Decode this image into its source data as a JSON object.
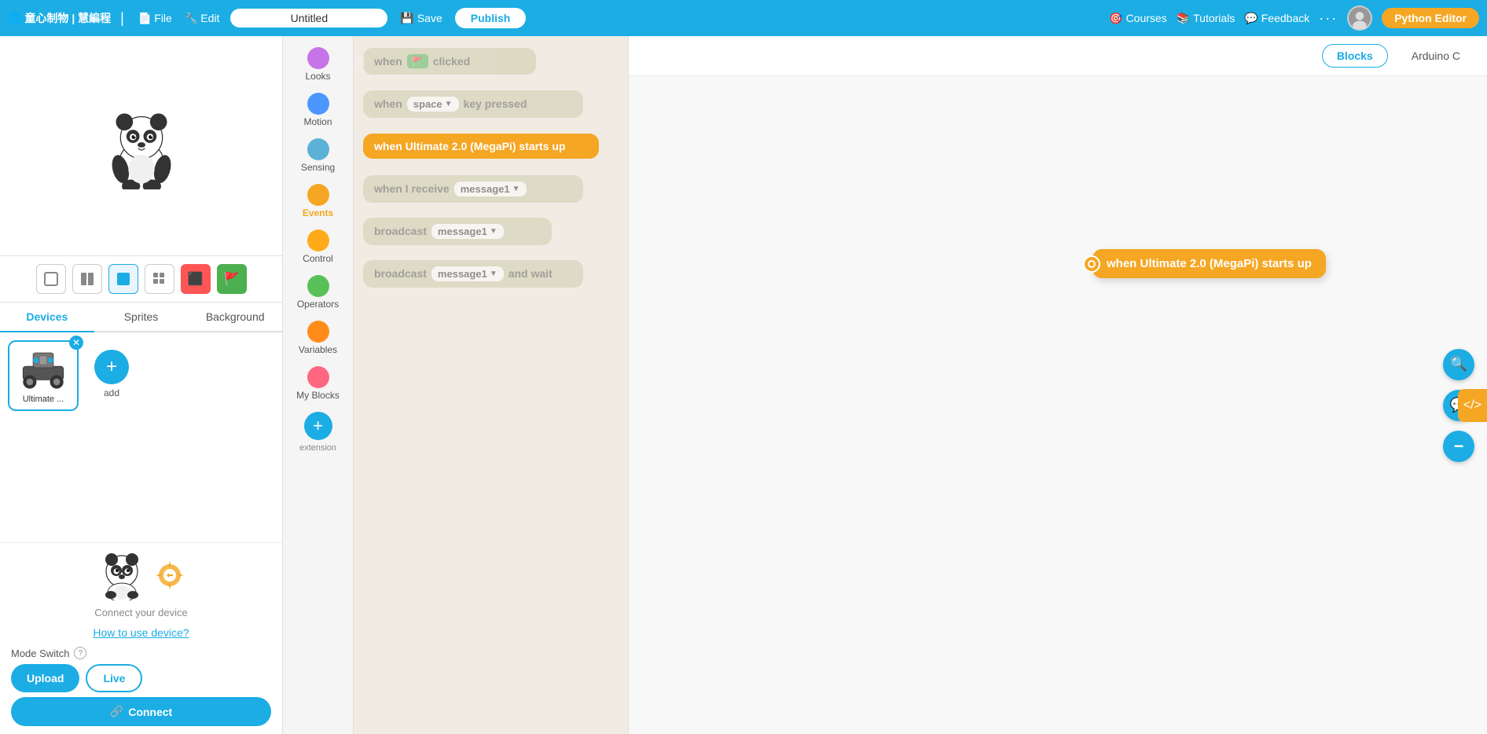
{
  "topnav": {
    "logo_text": "童心制物 | 慧編程",
    "file_label": "File",
    "edit_label": "Edit",
    "title_value": "Untitled",
    "save_label": "Save",
    "publish_label": "Publish",
    "courses_label": "Courses",
    "tutorials_label": "Tutorials",
    "feedback_label": "Feedback",
    "python_editor_label": "Python Editor",
    "save_icon": "💾"
  },
  "left_panel": {
    "tabs": [
      "Devices",
      "Sprites",
      "Background"
    ],
    "active_tab": "Devices",
    "device_name": "Ultimate ...",
    "add_label": "add",
    "sprite_connect_text": "Connect your device",
    "how_to_use_link": "How to use device?",
    "mode_switch_label": "Mode Switch",
    "upload_label": "Upload",
    "live_label": "Live",
    "connect_label": "Connect"
  },
  "categories": [
    {
      "id": "looks",
      "label": "Looks",
      "color": "#C774E8"
    },
    {
      "id": "motion",
      "label": "Motion",
      "color": "#4C97FF"
    },
    {
      "id": "sensing",
      "label": "Sensing",
      "color": "#5CB1D6"
    },
    {
      "id": "events",
      "label": "Events",
      "color": "#F5A623",
      "active": true
    },
    {
      "id": "control",
      "label": "Control",
      "color": "#FFAB19"
    },
    {
      "id": "operators",
      "label": "Operators",
      "color": "#59C059"
    },
    {
      "id": "variables",
      "label": "Variables",
      "color": "#FF8C1A"
    },
    {
      "id": "myblocks",
      "label": "My Blocks",
      "color": "#FF6680"
    }
  ],
  "blocks": [
    {
      "id": "when_flag",
      "type": "olive",
      "text": "when",
      "has_flag": true,
      "suffix": "clicked"
    },
    {
      "id": "when_key",
      "type": "olive",
      "text": "when",
      "key": "space",
      "suffix": "key pressed"
    },
    {
      "id": "when_starts",
      "type": "yellow",
      "text": "when Ultimate 2.0  (MegaPi)  starts up"
    },
    {
      "id": "when_receive",
      "type": "olive",
      "text": "when I receive",
      "pill": "message1"
    },
    {
      "id": "broadcast",
      "type": "olive",
      "text": "broadcast",
      "pill": "message1"
    },
    {
      "id": "broadcast_wait",
      "type": "olive",
      "text": "broadcast",
      "pill": "message1",
      "suffix": "and wait"
    }
  ],
  "workspace": {
    "tabs": [
      "Blocks",
      "Arduino C"
    ],
    "active_tab": "Blocks",
    "canvas_block_text": "when Ultimate 2.0  (MegaPi)  starts up"
  },
  "workspace_tools": {
    "search_icon": "🔍",
    "comment_icon": "💬",
    "minus_icon": "−"
  }
}
